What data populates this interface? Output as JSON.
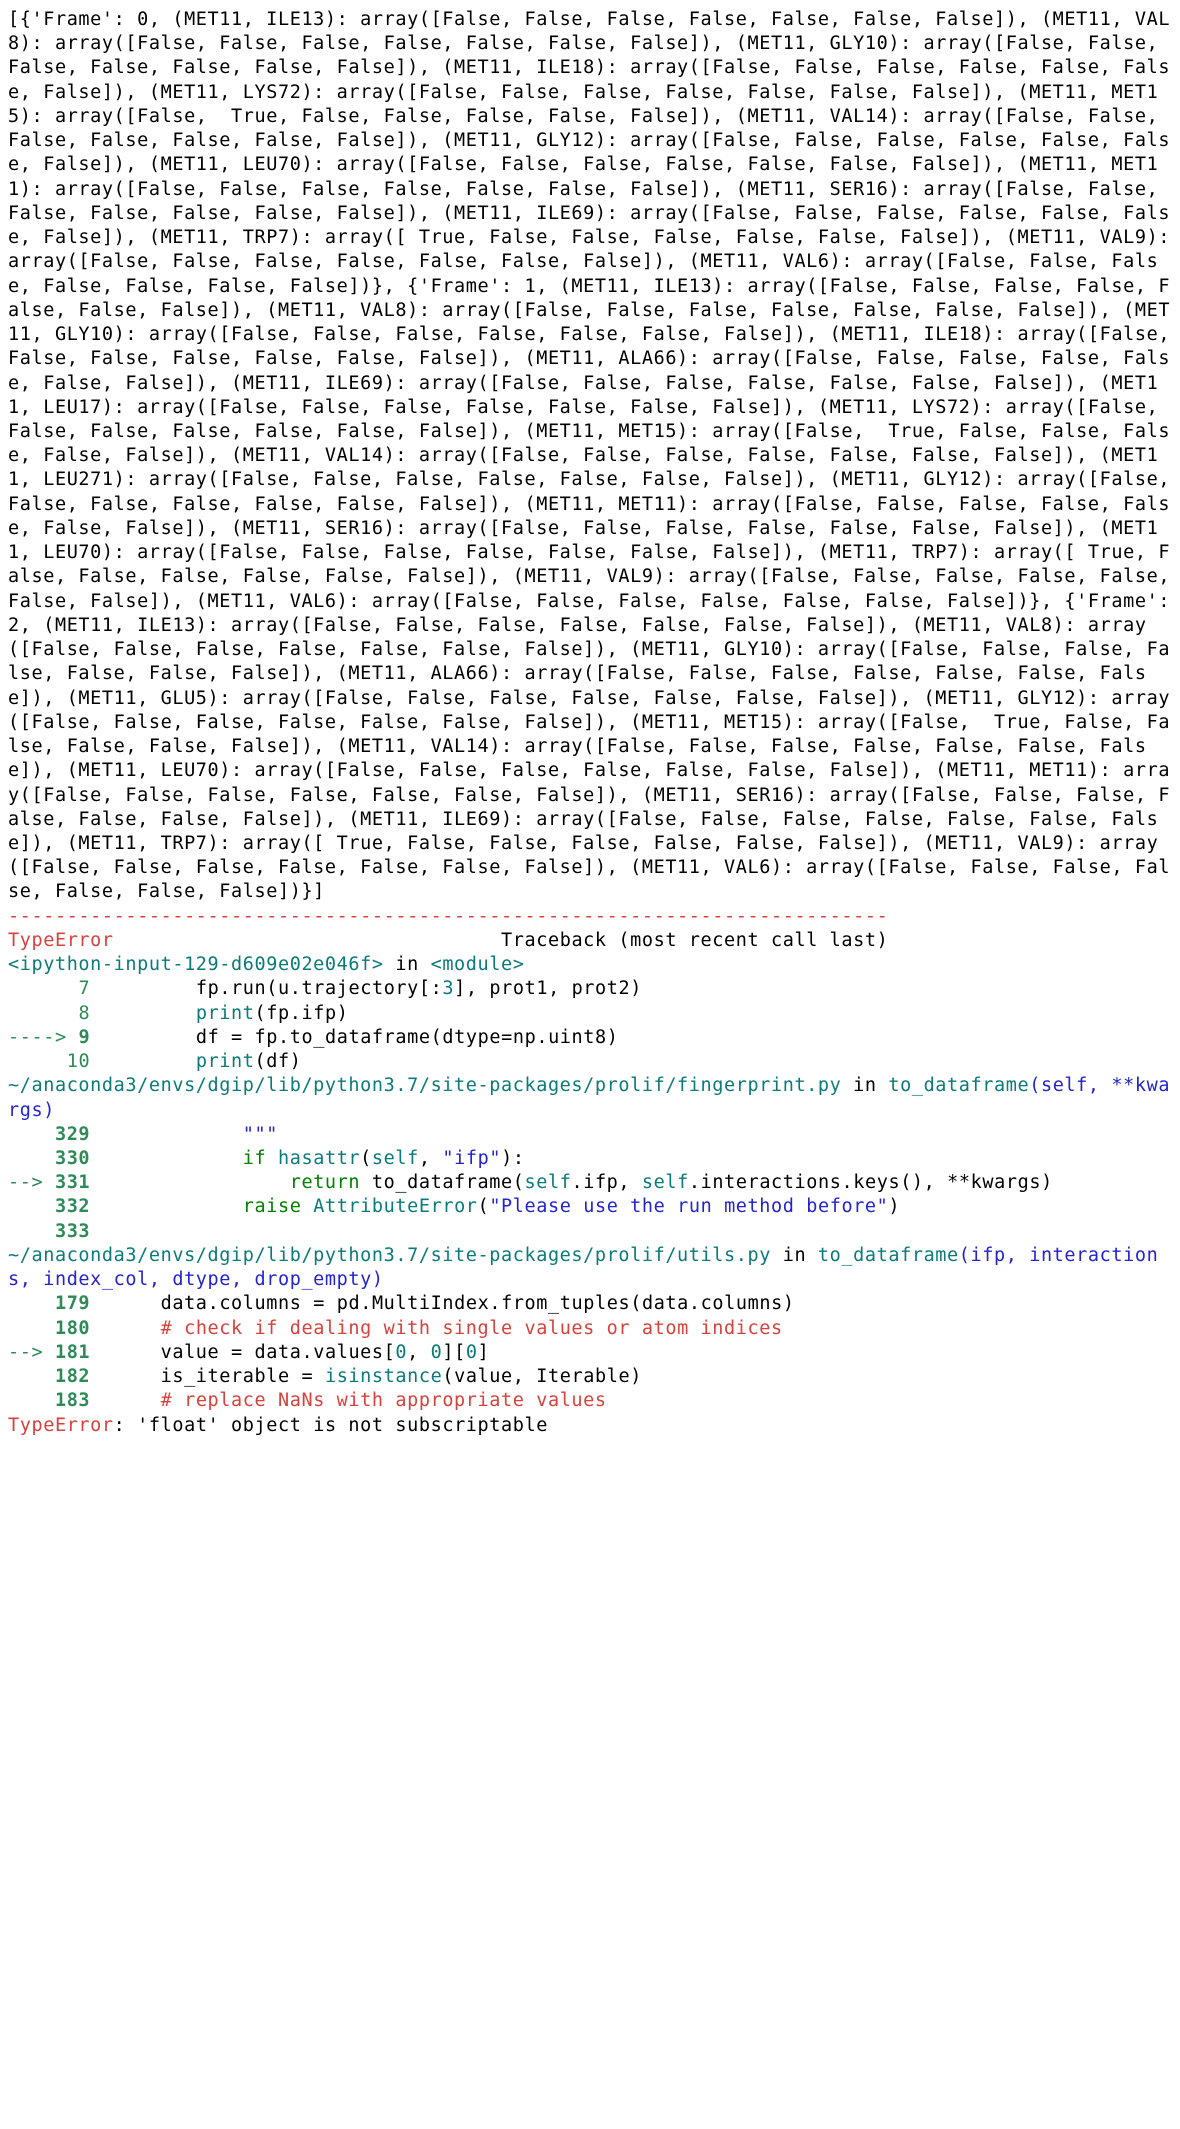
{
  "output_text": "[{'Frame': 0, (MET11, ILE13): array([False, False, False, False, False, False, False]), (MET11, VAL8): array([False, False, False, False, False, False, False]), (MET11, GLY10): array([False, False, False, False, False, False, False]), (MET11, ILE18): array([False, False, False, False, False, False, False]), (MET11, LYS72): array([False, False, False, False, False, False, False]), (MET11, MET15): array([False,  True, False, False, False, False, False]), (MET11, VAL14): array([False, False, False, False, False, False, False]), (MET11, GLY12): array([False, False, False, False, False, False, False]), (MET11, LEU70): array([False, False, False, False, False, False, False]), (MET11, MET11): array([False, False, False, False, False, False, False]), (MET11, SER16): array([False, False, False, False, False, False, False]), (MET11, ILE69): array([False, False, False, False, False, False, False]), (MET11, TRP7): array([ True, False, False, False, False, False, False]), (MET11, VAL9): array([False, False, False, False, False, False, False]), (MET11, VAL6): array([False, False, False, False, False, False, False])}, {'Frame': 1, (MET11, ILE13): array([False, False, False, False, False, False, False]), (MET11, VAL8): array([False, False, False, False, False, False, False]), (MET11, GLY10): array([False, False, False, False, False, False, False]), (MET11, ILE18): array([False, False, False, False, False, False, False]), (MET11, ALA66): array([False, False, False, False, False, False, False]), (MET11, ILE69): array([False, False, False, False, False, False, False]), (MET11, LEU17): array([False, False, False, False, False, False, False]), (MET11, LYS72): array([False, False, False, False, False, False, False]), (MET11, MET15): array([False,  True, False, False, False, False, False]), (MET11, VAL14): array([False, False, False, False, False, False, False]), (MET11, LEU271): array([False, False, False, False, False, False, False]), (MET11, GLY12): array([False, False, False, False, False, False, False]), (MET11, MET11): array([False, False, False, False, False, False, False]), (MET11, SER16): array([False, False, False, False, False, False, False]), (MET11, LEU70): array([False, False, False, False, False, False, False]), (MET11, TRP7): array([ True, False, False, False, False, False, False]), (MET11, VAL9): array([False, False, False, False, False, False, False]), (MET11, VAL6): array([False, False, False, False, False, False, False])}, {'Frame': 2, (MET11, ILE13): array([False, False, False, False, False, False, False]), (MET11, VAL8): array([False, False, False, False, False, False, False]), (MET11, GLY10): array([False, False, False, False, False, False, False]), (MET11, ALA66): array([False, False, False, False, False, False, False]), (MET11, GLU5): array([False, False, False, False, False, False, False]), (MET11, GLY12): array([False, False, False, False, False, False, False]), (MET11, MET15): array([False,  True, False, False, False, False, False]), (MET11, VAL14): array([False, False, False, False, False, False, False]), (MET11, LEU70): array([False, False, False, False, False, False, False]), (MET11, MET11): array([False, False, False, False, False, False, False]), (MET11, SER16): array([False, False, False, False, False, False, False]), (MET11, ILE69): array([False, False, False, False, False, False, False]), (MET11, TRP7): array([ True, False, False, False, False, False, False]), (MET11, VAL9): array([False, False, False, False, False, False, False]), (MET11, VAL6): array([False, False, False, False, False, False, False])}]",
  "separator": "---------------------------------------------------------------------------",
  "error": {
    "type": "TypeError",
    "header_right": "Traceback (most recent call last)",
    "final_message": "'float' object is not subscriptable"
  },
  "frames": [
    {
      "location_prefix": "<ipython-input-129-d609e02e046f>",
      "location_in": " in ",
      "location_func": "<module>",
      "lines": [
        {
          "arrow": "      ",
          "no": "7 ",
          "code_parts": [
            {
              "t": "        fp",
              "c": "k"
            },
            {
              "t": ".",
              "c": "k"
            },
            {
              "t": "run",
              "c": "k"
            },
            {
              "t": "(",
              "c": "k"
            },
            {
              "t": "u",
              "c": "k"
            },
            {
              "t": ".",
              "c": "k"
            },
            {
              "t": "trajectory",
              "c": "k"
            },
            {
              "t": "[:",
              "c": "k"
            },
            {
              "t": "3",
              "c": "c"
            },
            {
              "t": "],",
              "c": "k"
            },
            {
              "t": " prot1",
              "c": "k"
            },
            {
              "t": ",",
              "c": "k"
            },
            {
              "t": " prot2",
              "c": "k"
            },
            {
              "t": ")",
              "c": "k"
            }
          ]
        },
        {
          "arrow": "      ",
          "no": "8 ",
          "code_parts": [
            {
              "t": "        ",
              "c": "k"
            },
            {
              "t": "print",
              "c": "c"
            },
            {
              "t": "(",
              "c": "k"
            },
            {
              "t": "fp",
              "c": "k"
            },
            {
              "t": ".",
              "c": "k"
            },
            {
              "t": "ifp",
              "c": "k"
            },
            {
              "t": ")",
              "c": "k"
            }
          ]
        },
        {
          "arrow": "----> ",
          "no": "9 ",
          "bold": true,
          "code_parts": [
            {
              "t": "        df ",
              "c": "k"
            },
            {
              "t": "=",
              "c": "k"
            },
            {
              "t": " fp",
              "c": "k"
            },
            {
              "t": ".",
              "c": "k"
            },
            {
              "t": "to_dataframe",
              "c": "k"
            },
            {
              "t": "(",
              "c": "k"
            },
            {
              "t": "dtype",
              "c": "k"
            },
            {
              "t": "=",
              "c": "k"
            },
            {
              "t": "np",
              "c": "k"
            },
            {
              "t": ".",
              "c": "k"
            },
            {
              "t": "uint8",
              "c": "k"
            },
            {
              "t": ")",
              "c": "k"
            }
          ]
        },
        {
          "arrow": "     ",
          "no": "10 ",
          "code_parts": [
            {
              "t": "        ",
              "c": "k"
            },
            {
              "t": "print",
              "c": "c"
            },
            {
              "t": "(",
              "c": "k"
            },
            {
              "t": "df",
              "c": "k"
            },
            {
              "t": ")",
              "c": "k"
            }
          ]
        }
      ]
    },
    {
      "location_prefix": "~/anaconda3/envs/dgip/lib/python3.7/site-packages/prolif/fingerprint.py",
      "location_in": " in ",
      "location_func": "to_dataframe",
      "location_args": "(self, **kwargs)",
      "lines": [
        {
          "arrow": "    ",
          "no": "329 ",
          "bold": true,
          "code_parts": [
            {
              "t": "            ",
              "c": "k"
            },
            {
              "t": "\"\"\"",
              "c": "b"
            }
          ]
        },
        {
          "arrow": "    ",
          "no": "330 ",
          "bold": true,
          "code_parts": [
            {
              "t": "            ",
              "c": "k"
            },
            {
              "t": "if",
              "c": "g"
            },
            {
              "t": " ",
              "c": "k"
            },
            {
              "t": "hasattr",
              "c": "c"
            },
            {
              "t": "(",
              "c": "k"
            },
            {
              "t": "self",
              "c": "c"
            },
            {
              "t": ",",
              "c": "k"
            },
            {
              "t": " ",
              "c": "k"
            },
            {
              "t": "\"ifp\"",
              "c": "b"
            },
            {
              "t": "):",
              "c": "k"
            }
          ]
        },
        {
          "arrow": "--> ",
          "no": "331 ",
          "bold": true,
          "code_parts": [
            {
              "t": "                ",
              "c": "k"
            },
            {
              "t": "return",
              "c": "g"
            },
            {
              "t": " to_dataframe",
              "c": "k"
            },
            {
              "t": "(",
              "c": "k"
            },
            {
              "t": "self",
              "c": "c"
            },
            {
              "t": ".",
              "c": "k"
            },
            {
              "t": "ifp",
              "c": "k"
            },
            {
              "t": ",",
              "c": "k"
            },
            {
              "t": " ",
              "c": "k"
            },
            {
              "t": "self",
              "c": "c"
            },
            {
              "t": ".",
              "c": "k"
            },
            {
              "t": "interactions",
              "c": "k"
            },
            {
              "t": ".",
              "c": "k"
            },
            {
              "t": "keys",
              "c": "k"
            },
            {
              "t": "(),",
              "c": "k"
            },
            {
              "t": " ",
              "c": "k"
            },
            {
              "t": "**",
              "c": "k"
            },
            {
              "t": "kwargs",
              "c": "k"
            },
            {
              "t": ")",
              "c": "k"
            }
          ]
        },
        {
          "arrow": "    ",
          "no": "332 ",
          "bold": true,
          "code_parts": [
            {
              "t": "            ",
              "c": "k"
            },
            {
              "t": "raise",
              "c": "g"
            },
            {
              "t": " ",
              "c": "k"
            },
            {
              "t": "AttributeError",
              "c": "c"
            },
            {
              "t": "(",
              "c": "k"
            },
            {
              "t": "\"Please use the run method before\"",
              "c": "b"
            },
            {
              "t": ")",
              "c": "k"
            }
          ]
        },
        {
          "arrow": "    ",
          "no": "333 ",
          "bold": true,
          "code_parts": []
        }
      ]
    },
    {
      "location_prefix": "~/anaconda3/envs/dgip/lib/python3.7/site-packages/prolif/utils.py",
      "location_in": " in ",
      "location_func": "to_dataframe",
      "location_args": "(ifp, interactions, index_col, dtype, drop_empty)",
      "lines": [
        {
          "arrow": "    ",
          "no": "179 ",
          "bold": true,
          "code_parts": [
            {
              "t": "     data",
              "c": "k"
            },
            {
              "t": ".",
              "c": "k"
            },
            {
              "t": "columns ",
              "c": "k"
            },
            {
              "t": "=",
              "c": "k"
            },
            {
              "t": " pd",
              "c": "k"
            },
            {
              "t": ".",
              "c": "k"
            },
            {
              "t": "MultiIndex",
              "c": "k"
            },
            {
              "t": ".",
              "c": "k"
            },
            {
              "t": "from_tuples",
              "c": "k"
            },
            {
              "t": "(",
              "c": "k"
            },
            {
              "t": "data",
              "c": "k"
            },
            {
              "t": ".",
              "c": "k"
            },
            {
              "t": "columns",
              "c": "k"
            },
            {
              "t": ")",
              "c": "k"
            }
          ]
        },
        {
          "arrow": "    ",
          "no": "180 ",
          "bold": true,
          "code_parts": [
            {
              "t": "     ",
              "c": "k"
            },
            {
              "t": "# check if dealing with single values or atom indices",
              "c": "r"
            }
          ]
        },
        {
          "arrow": "--> ",
          "no": "181 ",
          "bold": true,
          "code_parts": [
            {
              "t": "     value ",
              "c": "k"
            },
            {
              "t": "=",
              "c": "k"
            },
            {
              "t": " data",
              "c": "k"
            },
            {
              "t": ".",
              "c": "k"
            },
            {
              "t": "values",
              "c": "k"
            },
            {
              "t": "[",
              "c": "k"
            },
            {
              "t": "0",
              "c": "c"
            },
            {
              "t": ",",
              "c": "k"
            },
            {
              "t": " ",
              "c": "k"
            },
            {
              "t": "0",
              "c": "c"
            },
            {
              "t": "][",
              "c": "k"
            },
            {
              "t": "0",
              "c": "c"
            },
            {
              "t": "]",
              "c": "k"
            }
          ]
        },
        {
          "arrow": "    ",
          "no": "182 ",
          "bold": true,
          "code_parts": [
            {
              "t": "     is_iterable ",
              "c": "k"
            },
            {
              "t": "=",
              "c": "k"
            },
            {
              "t": " ",
              "c": "k"
            },
            {
              "t": "isinstance",
              "c": "c"
            },
            {
              "t": "(",
              "c": "k"
            },
            {
              "t": "value",
              "c": "k"
            },
            {
              "t": ",",
              "c": "k"
            },
            {
              "t": " Iterable",
              "c": "k"
            },
            {
              "t": ")",
              "c": "k"
            }
          ]
        },
        {
          "arrow": "    ",
          "no": "183 ",
          "bold": true,
          "code_parts": [
            {
              "t": "     ",
              "c": "k"
            },
            {
              "t": "# replace NaNs with appropriate values",
              "c": "r"
            }
          ]
        }
      ]
    }
  ]
}
